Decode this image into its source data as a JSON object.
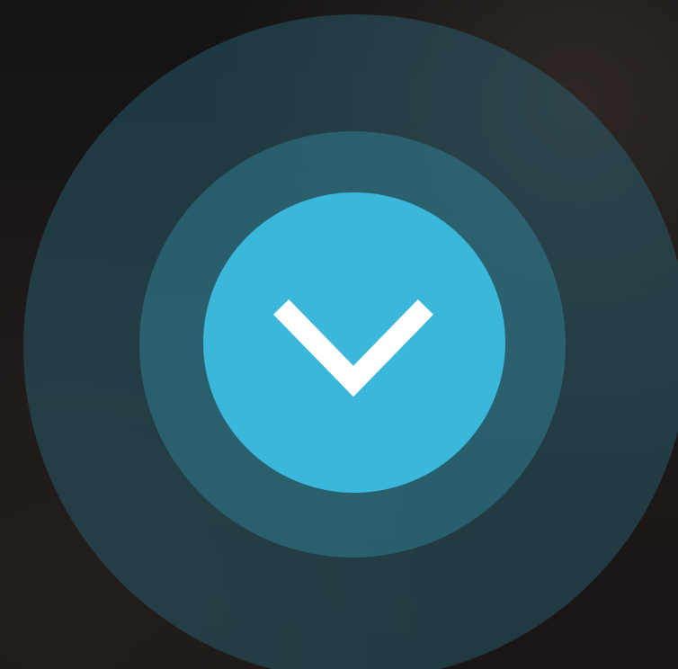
{
  "control": {
    "icon": "chevron-down-icon",
    "colors": {
      "background": "#1a1616",
      "outer_ring": "#2a6e80",
      "middle_ring": "#348aa0",
      "button_fill": "#3bb7db",
      "icon": "#ffffff"
    }
  }
}
